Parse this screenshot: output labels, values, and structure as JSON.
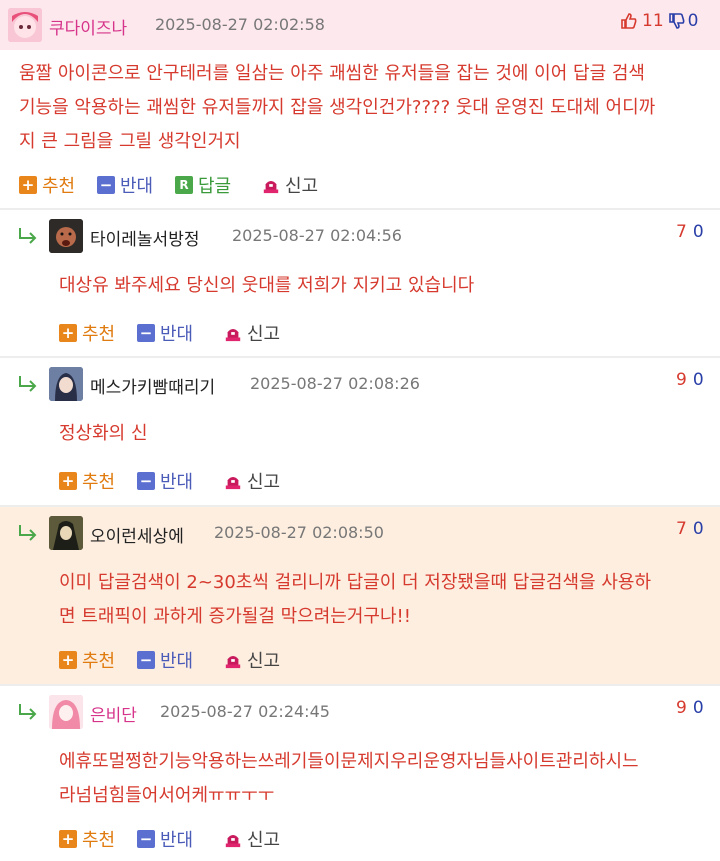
{
  "labels": {
    "recommend": "추천",
    "oppose": "반대",
    "reply": "답글",
    "report": "신고"
  },
  "comments": [
    {
      "author": "쿠다이즈나",
      "date": "2025-08-27 02:02:58",
      "up": "11",
      "down": "0",
      "lines": [
        "움짤 아이콘으로 안구테러를 일삼는 아주 괘씸한 유저들을 잡는 것에 이어 답글 검색",
        "기능을 악용하는 괘씸한 유저들까지 잡을 생각인건가???? 웃대 운영진 도대체 어디까",
        "지 큰 그림을 그릴 생각인거지"
      ]
    },
    {
      "author": "타이레놀서방정",
      "date": "2025-08-27 02:04:56",
      "up": "7",
      "down": "0",
      "lines": [
        "대상유 봐주세요 당신의 웃대를 저희가 지키고 있습니다"
      ]
    },
    {
      "author": "메스가키빰때리기",
      "date": "2025-08-27 02:08:26",
      "up": "9",
      "down": "0",
      "lines": [
        "정상화의 신"
      ]
    },
    {
      "author": "오이런세상에",
      "date": "2025-08-27 02:08:50",
      "up": "7",
      "down": "0",
      "lines": [
        "이미 답글검색이 2~30초씩 걸리니까 답글이 더 저장됐을때 답글검색을 사용하",
        "면 트래픽이 과하게 증가될걸 막으려는거구나!!"
      ]
    },
    {
      "author": "은비단",
      "date": "2025-08-27 02:24:45",
      "up": "9",
      "down": "0",
      "lines": [
        "에휴또멀쩡한기능악용하는쓰레기들이문제지우리운영자님들사이트관리하시느",
        "라넘넘힘들어서어케ㅠㅠㅜㅜ"
      ]
    }
  ],
  "colors": {
    "header_bg": "#fde8ee",
    "highlight_bg": "#fdeee0",
    "comment_text": "#d63a2e",
    "author_pink": "#d6338a",
    "recommend": "#e8861c",
    "oppose": "#5b6fd0"
  }
}
